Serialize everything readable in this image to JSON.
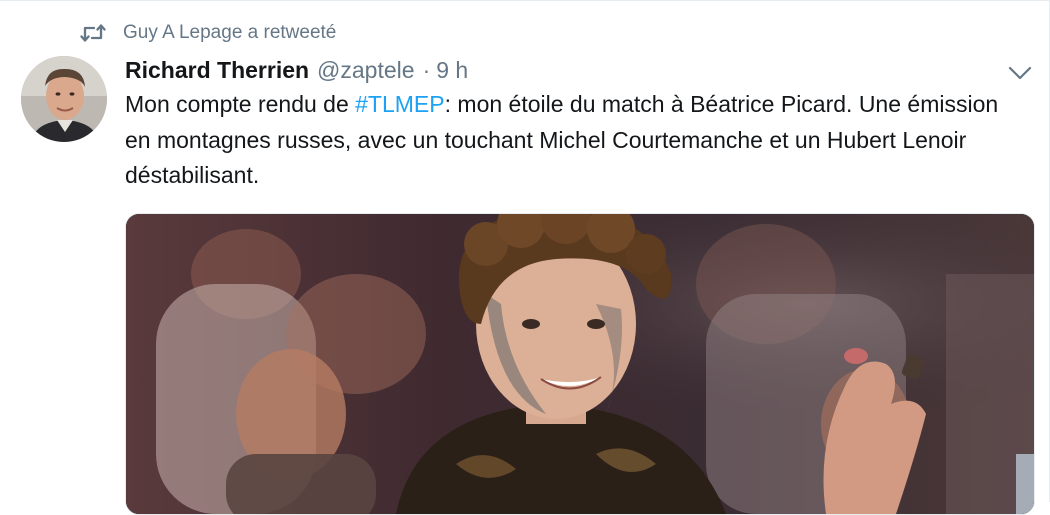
{
  "retweet": {
    "icon": "retweet-icon",
    "text": "Guy A Lepage a retweeté"
  },
  "tweet": {
    "author": {
      "name": "Richard Therrien",
      "handle": "@zaptele",
      "avatar_icon": "avatar-image"
    },
    "separator": "·",
    "time": "9 h",
    "text": {
      "part1": "Mon compte rendu de ",
      "hashtag": "#TLMEP",
      "part2": ": mon étoile du match à Béatrice Picard. Une émission en montagnes russes, avec un touchant Michel Courtemanche et un Hubert Lenoir déstabilisant."
    },
    "menu_icon": "chevron-down-icon",
    "media_icon": "tweet-photo"
  },
  "colors": {
    "link": "#1da1f2",
    "secondary_text": "#657786",
    "primary_text": "#14171a",
    "border": "#e6ecf0"
  }
}
